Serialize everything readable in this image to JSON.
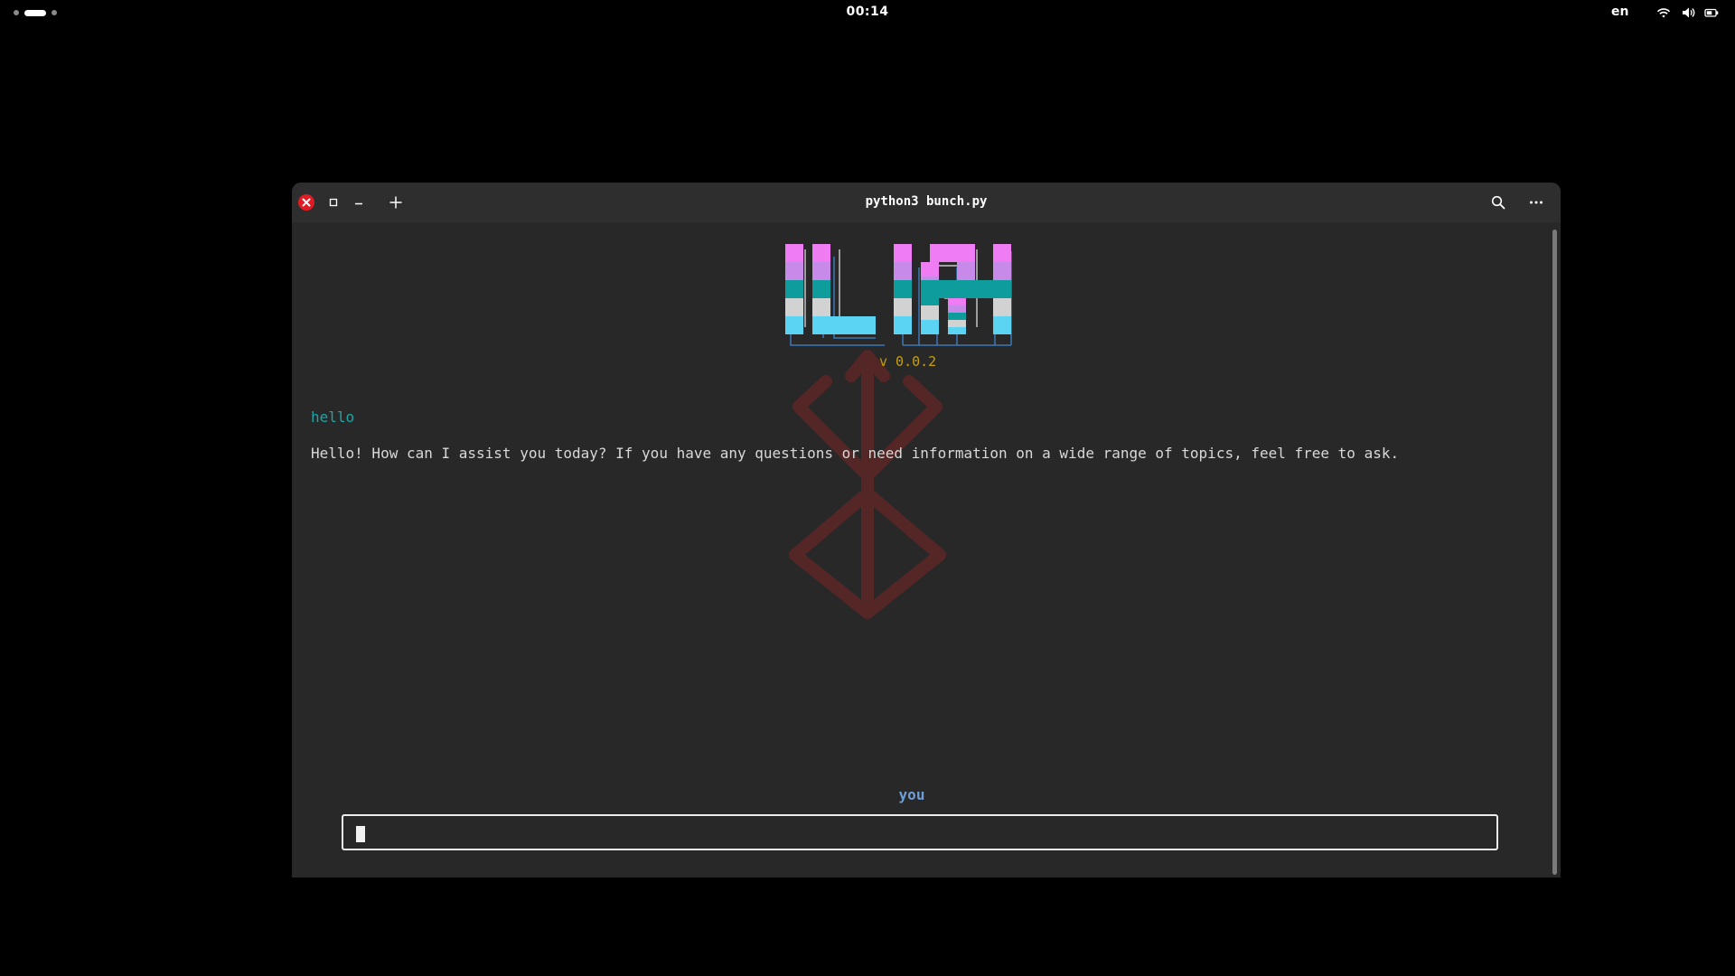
{
  "system_bar": {
    "clock": "00:14",
    "language": "en",
    "tray_icons": [
      "wifi-icon",
      "volume-icon",
      "battery-icon"
    ]
  },
  "window": {
    "title": "python3 bunch.py",
    "buttons": [
      "close-icon",
      "maximize-icon",
      "minimize-icon",
      "new-tab-icon",
      "search-icon",
      "menu-icon"
    ]
  },
  "terminal": {
    "logo_icon": "llm-ascii-logo",
    "version": "v 0.0.2",
    "messages": [
      {
        "role": "user",
        "text": "hello"
      },
      {
        "role": "assistant",
        "text": "Hello! How can I assist you today? If you have any questions or need information on a wide range of topics, feel free to ask."
      }
    ],
    "prompt_label": "you",
    "input_value": ""
  },
  "colors": {
    "user_text": "#1aa6a6",
    "assistant_text": "#d8d8d8",
    "version_text": "#c7a008",
    "prompt_label": "#6e9ed6",
    "emblem": "#5a2626",
    "close_button": "#e01b24",
    "logo_pink": "#f07cf4",
    "logo_violet": "#c78ae8",
    "logo_teal": "#0f9c9c",
    "logo_silver": "#d2d2d2",
    "logo_cyan": "#5bd3f2",
    "logo_shadow": "#3a78b8"
  }
}
